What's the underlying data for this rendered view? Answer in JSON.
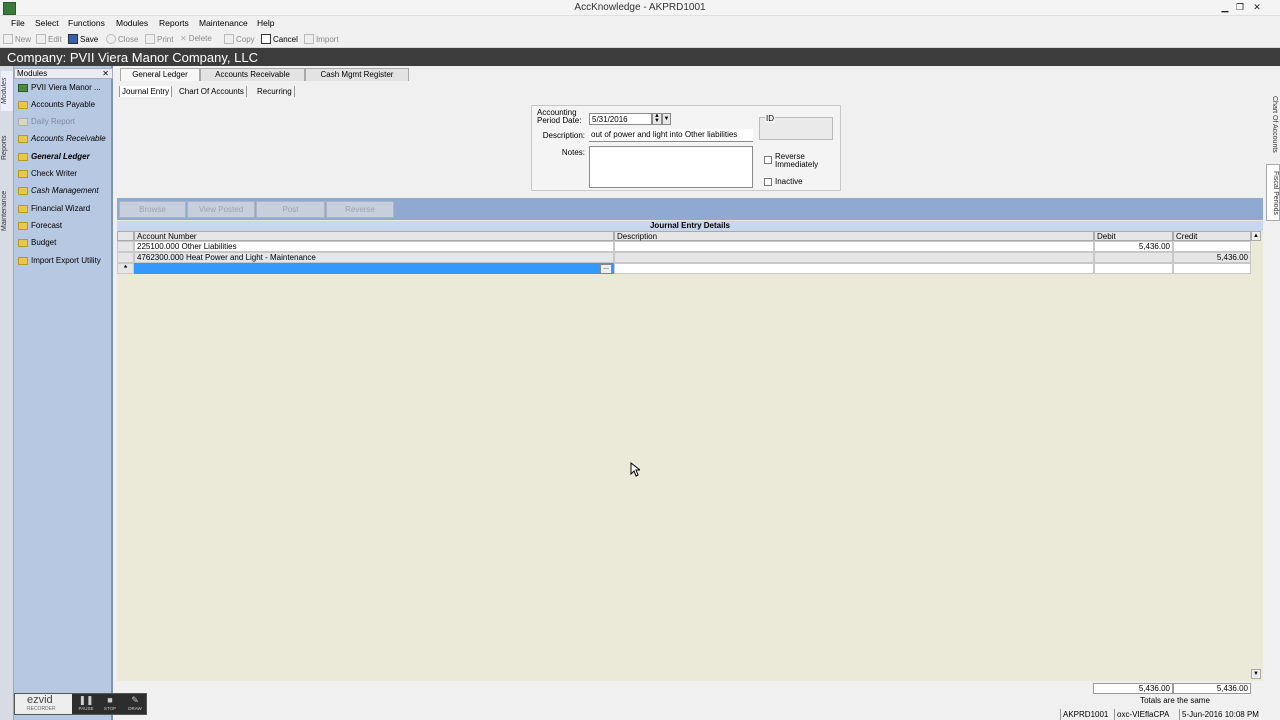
{
  "window": {
    "title": "AccKnowledge - AKPRD1001"
  },
  "menu": [
    "File",
    "Select",
    "Functions",
    "Modules",
    "Reports",
    "Maintenance",
    "Help"
  ],
  "toolbar": {
    "new": "New",
    "edit": "Edit",
    "save": "Save",
    "close": "Close",
    "print": "Print",
    "delete": "Delete",
    "copy": "Copy",
    "cancel": "Cancel",
    "import": "Import"
  },
  "company": {
    "title": "Company: PVII Viera Manor Company, LLC"
  },
  "vertical_tabs": [
    "Modules",
    "Reports",
    "Maintenance"
  ],
  "modules": {
    "header": "Modules",
    "items": [
      "PVII Viera Manor ...",
      "Accounts Payable",
      "Daily Report",
      "Accounts Receivable",
      "General Ledger",
      "Check Writer",
      "Cash Management",
      "Financial Wizard",
      "Forecast",
      "Budget",
      "Import Export Utility"
    ]
  },
  "top_tabs": [
    "General Ledger",
    "Accounts Receivable",
    "Cash Mgmt Register"
  ],
  "sub_tabs": [
    "Journal Entry",
    "Chart Of Accounts",
    "Recurring"
  ],
  "form": {
    "period_label_1": "Accounting",
    "period_label_2": "Period Date:",
    "period_value": "5/31/2016",
    "description_label": "Description:",
    "description_value": "out of power and light into Other liabilities",
    "notes_label": "Notes:",
    "id_label": "ID",
    "reverse_label_1": "Reverse",
    "reverse_label_2": "Immediately",
    "inactive_label": "Inactive"
  },
  "actions": [
    "Browse",
    "View Posted",
    "Post",
    "Reverse"
  ],
  "grid": {
    "title": "Journal Entry Details",
    "columns": [
      "Account Number",
      "Description",
      "Debit",
      "Credit"
    ],
    "rows": [
      {
        "account": "225100.000 Other Liabilities",
        "description": "",
        "debit": "5,436.00",
        "credit": ""
      },
      {
        "account": "4762300.000 Heat Power and Light - Maintenance",
        "description": "",
        "debit": "",
        "credit": "5,436.00"
      }
    ],
    "new_row_marker": "*",
    "ellipsis": "..."
  },
  "right_tabs": [
    "Chart Of Accounts",
    "Fiscal Periods"
  ],
  "totals": {
    "debit": "5,436.00",
    "credit": "5,436.00",
    "message": "Totals are the same"
  },
  "statusbar": [
    "AKPRD1001",
    "oxc-VIEflaCPA",
    "5-Jun-2016 10:08 PM"
  ],
  "recorder": {
    "brand": "ezvid",
    "sub": "RECORDER",
    "pause": "PAUSE",
    "stop": "STOP",
    "draw": "DRAW"
  }
}
